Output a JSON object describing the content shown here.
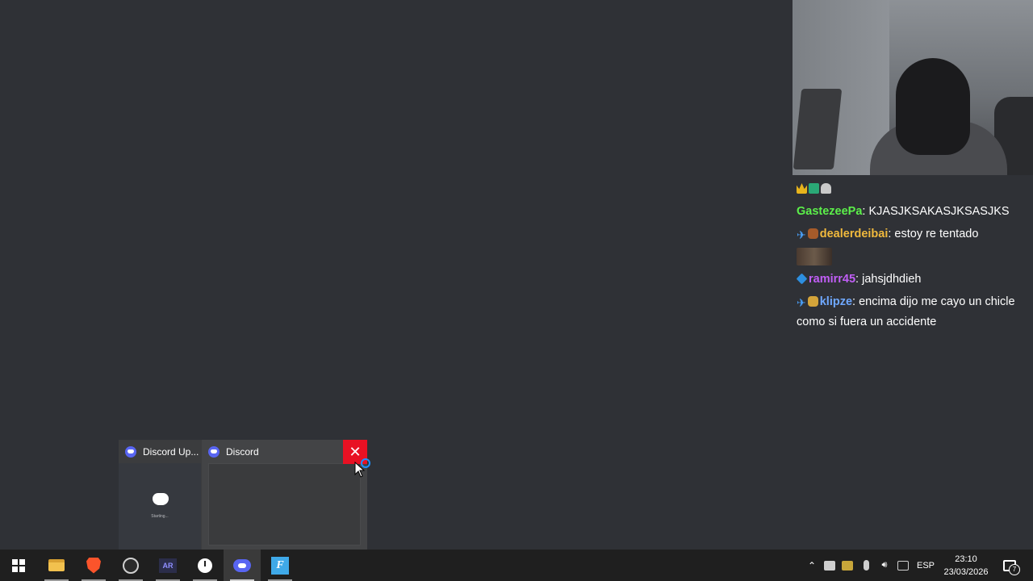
{
  "chat": {
    "messages": [
      {
        "user": "GastezeePa",
        "user_color": "#5cf04a",
        "text": "KJASJKSAKASJKSASJKS"
      },
      {
        "user": "dealerdeibai",
        "user_color": "#f0b93d",
        "text": "estoy re tentado"
      },
      {
        "user": "ramirr45",
        "user_color": "#c15ef7",
        "text": "jahsjdhdieh"
      },
      {
        "user": "klipze",
        "user_color": "#6fa8ff",
        "text": "encima dijo me cayo un chicle como si fuera un accidente"
      }
    ]
  },
  "preview": {
    "thumb1_title": "Discord Up...",
    "thumb1_splash_text": "Starting...",
    "thumb2_title": "Discord",
    "close_glyph": "✕"
  },
  "taskbar": {
    "apps": [
      "start-icon",
      "file-explorer-icon",
      "brave-icon",
      "obs-icon",
      "ar-icon",
      "clock-icon",
      "discord-icon",
      "f-app-icon"
    ],
    "ar_label": "AR",
    "f_label": "F",
    "tray_chevron": "⌃",
    "language": "ESP",
    "time": "23:10",
    "date": "23/03/2026",
    "notification_count": "7"
  }
}
